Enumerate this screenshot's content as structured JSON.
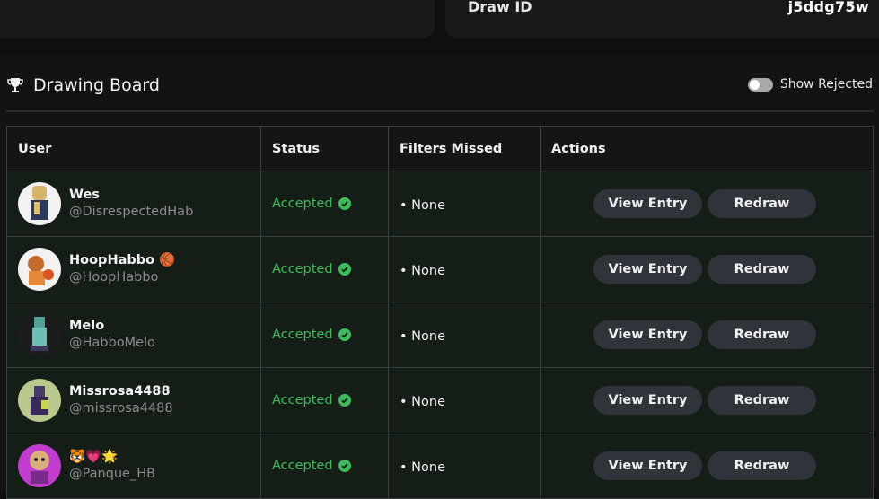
{
  "draw": {
    "id_label": "Draw ID",
    "id_value": "j5ddg75w"
  },
  "board": {
    "title": "Drawing Board",
    "toggle_label": "Show Rejected",
    "toggle_on": false
  },
  "table": {
    "headers": {
      "user": "User",
      "status": "Status",
      "filters": "Filters Missed",
      "actions": "Actions"
    },
    "view_label": "View Entry",
    "redraw_label": "Redraw",
    "rows": [
      {
        "name": "Wes",
        "handle": "@DisrespectedHab",
        "status": "Accepted",
        "filters": "• None",
        "avatar_color": "#f2f2f2"
      },
      {
        "name": "HoopHabbo 🏀",
        "handle": "@HoopHabbo",
        "status": "Accepted",
        "filters": "• None",
        "avatar_color": "#f2f2f2"
      },
      {
        "name": "Melo",
        "handle": "@HabboMelo",
        "status": "Accepted",
        "filters": "• None",
        "avatar_color": "#1c1c1c"
      },
      {
        "name": "Missrosa4488",
        "handle": "@missrosa4488",
        "status": "Accepted",
        "filters": "• None",
        "avatar_color": "#b9c98d"
      },
      {
        "name": "🐯💗🌟",
        "handle": "@Panque_HB",
        "status": "Accepted",
        "filters": "• None",
        "avatar_color": "#c23dcf"
      }
    ]
  },
  "colors": {
    "accent_green": "#3dbb5a",
    "button_bg": "#2f343b",
    "row_bg": "#141d16"
  }
}
